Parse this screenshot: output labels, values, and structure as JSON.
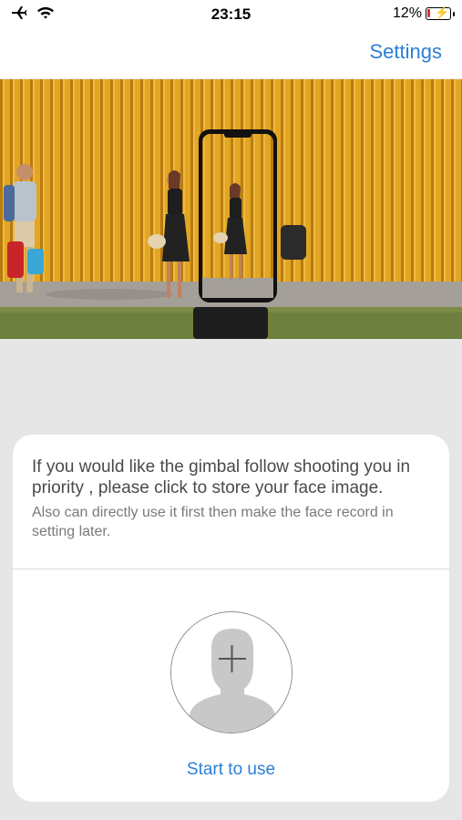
{
  "status": {
    "time": "23:15",
    "battery_percent": "12%",
    "battery_level": 0.12,
    "icons": [
      "airplane-icon",
      "wifi-icon",
      "battery-charging-icon"
    ]
  },
  "nav": {
    "settings_label": "Settings"
  },
  "card": {
    "title": "If you would like the gimbal follow shooting you in priority , please click to store your face image.",
    "subtitle": "Also can directly use it first then make the face record in setting later.",
    "start_label": "Start to use",
    "avatar_icon": "face-placeholder-add-icon"
  },
  "colors": {
    "accent": "#2a7fd6",
    "background": "#e6e6e6",
    "card": "#ffffff",
    "hero_wall": "#d89a1a"
  }
}
